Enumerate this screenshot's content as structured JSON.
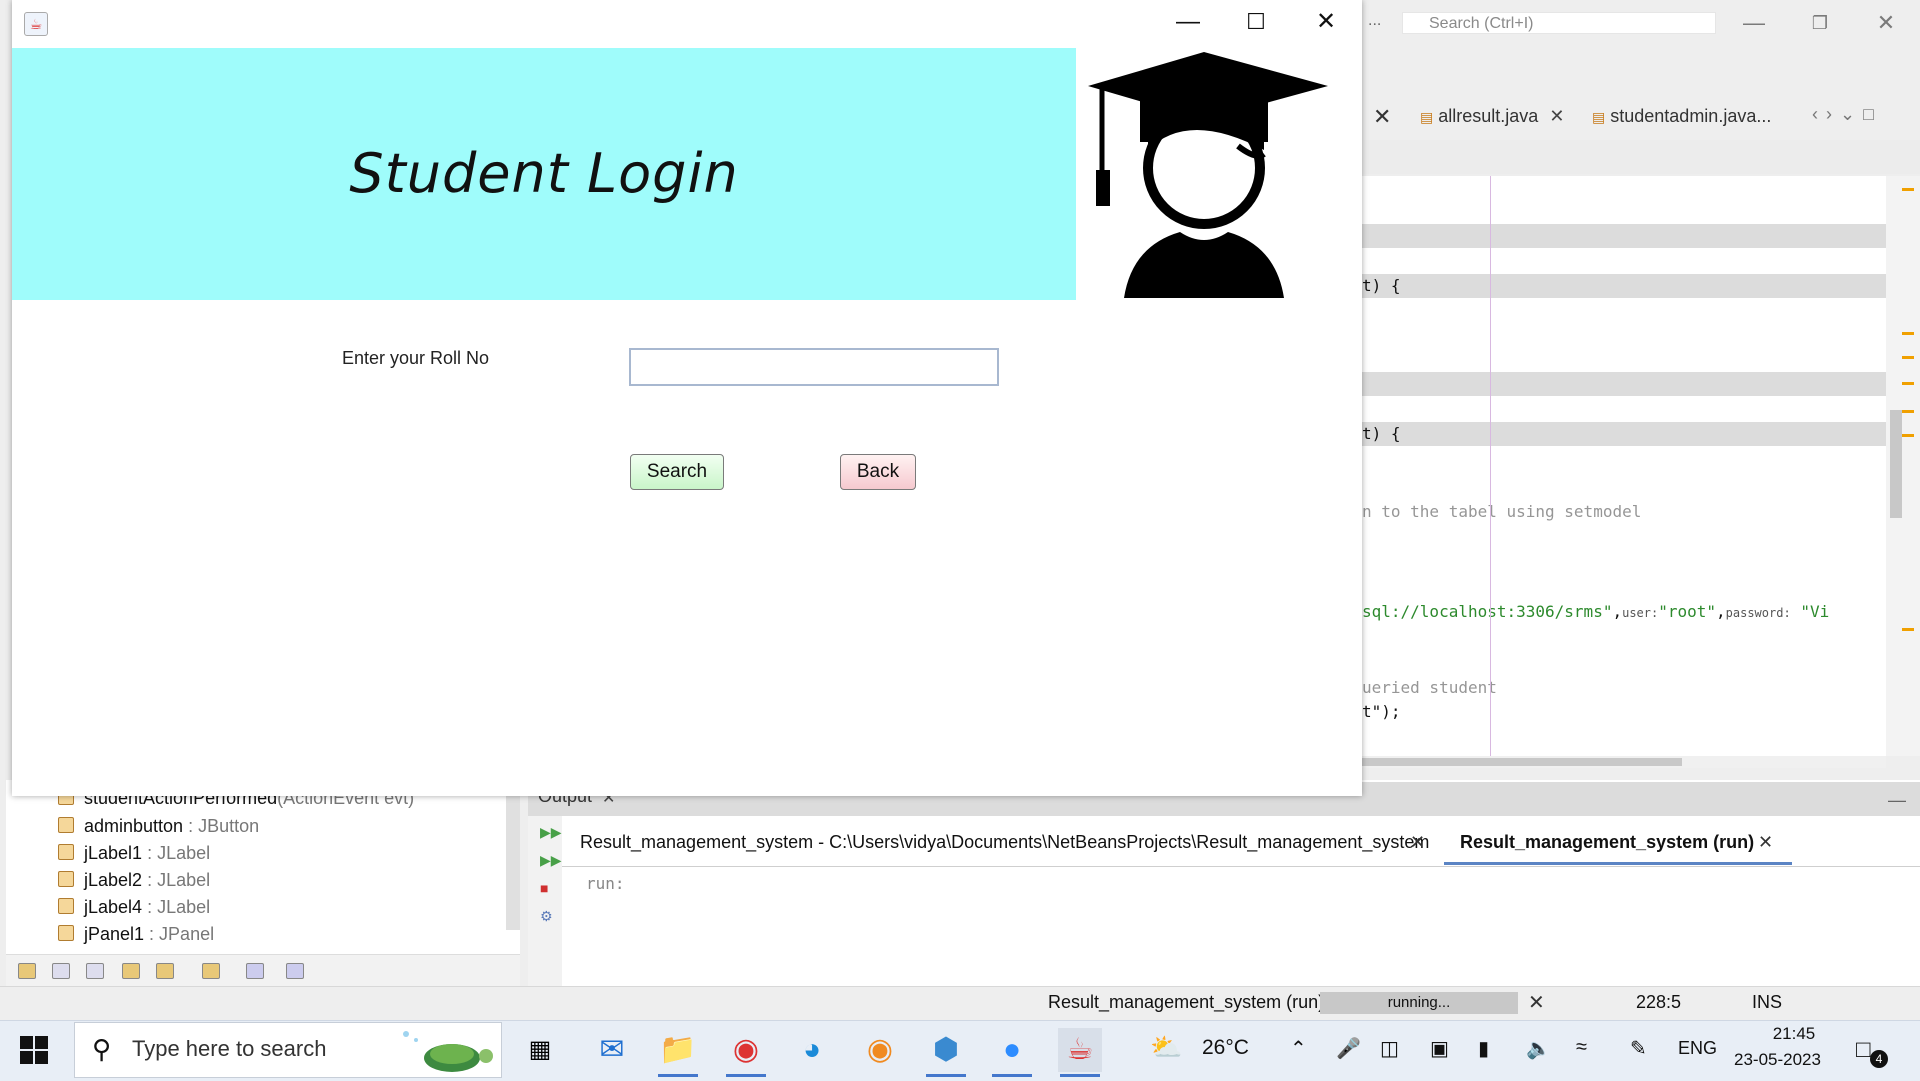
{
  "ide": {
    "search_placeholder": "Search (Ctrl+I)",
    "dots": "...",
    "tabs": [
      {
        "label": "allresult.java"
      },
      {
        "label": "studentadmin.java..."
      }
    ],
    "code": [
      {
        "text": "t) {"
      },
      {
        "text": "t) {"
      },
      {
        "comment": "n to the tabel using setmodel"
      },
      {
        "str1": "sql://localhost:3306/srms\"",
        "hint_user": "user:",
        "str2": "\"root\"",
        "hint_pass": "password:",
        "str3": "\"Vi"
      },
      {
        "comment": "ueried student"
      },
      {
        "text": "t\");"
      }
    ],
    "navigator": {
      "rows": [
        {
          "name": "studentActionPerformed",
          "type": "(ActionEvent evt)"
        },
        {
          "name": "adminbutton",
          "type": " : JButton"
        },
        {
          "name": "jLabel1",
          "type": " : JLabel"
        },
        {
          "name": "jLabel2",
          "type": " : JLabel"
        },
        {
          "name": "jLabel4",
          "type": " : JLabel"
        },
        {
          "name": "jPanel1",
          "type": " : JPanel"
        }
      ]
    },
    "output": {
      "title": "Output",
      "tab1": "Result_management_system - C:\\Users\\vidya\\Documents\\NetBeansProjects\\Result_management_system",
      "tab2": "Result_management_system (run)",
      "text": "run:"
    },
    "status": {
      "task": "Result_management_system (run)",
      "progress": "running...",
      "position": "228:5",
      "mode": "INS"
    }
  },
  "java_window": {
    "header_title": "Student Login",
    "roll_label": "Enter your Roll No",
    "roll_value": "",
    "search_label": "Search",
    "back_label": "Back",
    "header_color": "#9ffcfb"
  },
  "taskbar": {
    "search_text": "Type here to search",
    "temperature": "26°C",
    "language": "ENG",
    "time": "21:45",
    "date": "23-05-2023",
    "notification_count": "4"
  }
}
